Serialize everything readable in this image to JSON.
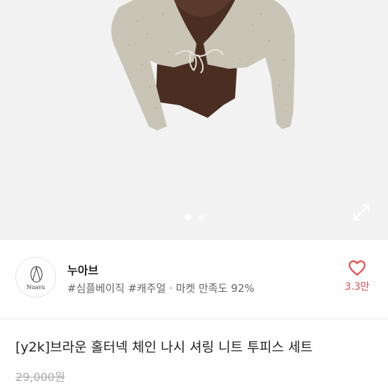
{
  "gallery": {
    "current_index": 1,
    "total_images": 2,
    "expand_icon": "expand-icon"
  },
  "seller": {
    "avatar_text": "Nuavu",
    "name": "누아브",
    "tags": "#심플베이직 #캐주얼 · 마켓 만족도 92%",
    "likes": "3.3만",
    "like_icon": "heart-icon"
  },
  "product": {
    "title": "[y2k]브라운 홀터넥 체인 나시 셔링 니트 투피스 세트",
    "original_price": "29,000원"
  },
  "colors": {
    "like_red": "#e5484d",
    "knit_gray": "#c8c4b6",
    "top_brown": "#4a2e22"
  }
}
